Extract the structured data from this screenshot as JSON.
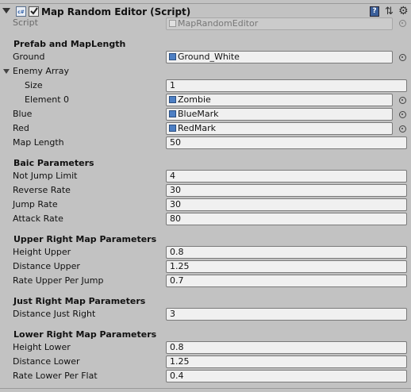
{
  "header": {
    "title": "Map Random Editor (Script)",
    "component_icon_text": "c#",
    "enabled": true,
    "help_icon": "help-book-icon",
    "settings_icon": "gear-icon"
  },
  "script_row": {
    "label": "Script",
    "value": "MapRandomEditor"
  },
  "prefab_section": {
    "title": "Prefab and MapLength",
    "ground": {
      "label": "Ground",
      "value": "Ground_White"
    },
    "enemy_array": {
      "label": "Enemy Array",
      "size_label": "Size",
      "size_value": "1",
      "element0_label": "Element 0",
      "element0_value": "Zombie"
    },
    "blue": {
      "label": "Blue",
      "value": "BlueMark"
    },
    "red": {
      "label": "Red",
      "value": "RedMark"
    },
    "map_length": {
      "label": "Map Length",
      "value": "50"
    }
  },
  "basic_section": {
    "title": "Baic Parameters",
    "not_jump_limit": {
      "label": "Not Jump Limit",
      "value": "4"
    },
    "reverse_rate": {
      "label": "Reverse Rate",
      "value": "30"
    },
    "jump_rate": {
      "label": "Jump Rate",
      "value": "30"
    },
    "attack_rate": {
      "label": "Attack Rate",
      "value": "80"
    }
  },
  "upper_section": {
    "title": "Upper Right Map Parameters",
    "height_upper": {
      "label": "Height Upper",
      "value": "0.8"
    },
    "distance_upper": {
      "label": "Distance Upper",
      "value": "1.25"
    },
    "rate_upper": {
      "label": "Rate Upper Per Jump",
      "value": "0.7"
    }
  },
  "just_section": {
    "title": "Just Right Map Parameters",
    "distance_just": {
      "label": "Distance Just Right",
      "value": "3"
    }
  },
  "lower_section": {
    "title": "Lower Right Map Parameters",
    "height_lower": {
      "label": "Height Lower",
      "value": "0.8"
    },
    "distance_lower": {
      "label": "Distance Lower",
      "value": "1.25"
    },
    "rate_lower": {
      "label": "Rate Lower Per Flat",
      "value": "0.4"
    }
  }
}
